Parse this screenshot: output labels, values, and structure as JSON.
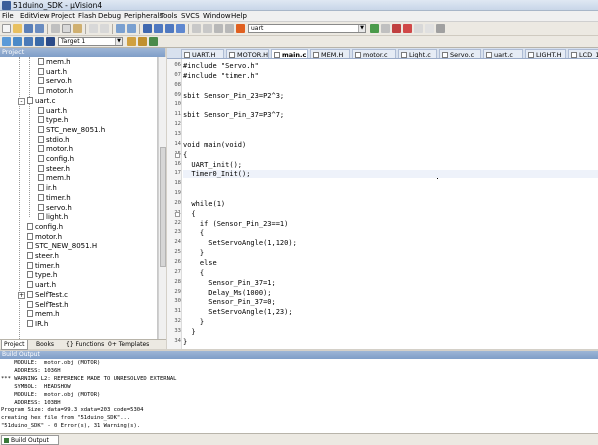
{
  "window": {
    "title": "51duino_SDK - µVision4"
  },
  "menu": [
    "File",
    "Edit",
    "View",
    "Project",
    "Flash",
    "Debug",
    "Peripherals",
    "Tools",
    "SVCS",
    "Window",
    "Help"
  ],
  "toolbar": {
    "find_combo": "uart",
    "target_combo": "Target 1"
  },
  "project_panel": {
    "header": "Project",
    "tree": [
      {
        "label": "mem.h",
        "level": 3,
        "expander": ""
      },
      {
        "label": "uart.h",
        "level": 3,
        "expander": ""
      },
      {
        "label": "servo.h",
        "level": 3,
        "expander": ""
      },
      {
        "label": "motor.h",
        "level": 3,
        "expander": ""
      },
      {
        "label": "uart.c",
        "level": 2,
        "expander": "-"
      },
      {
        "label": "uart.h",
        "level": 3,
        "expander": ""
      },
      {
        "label": "type.h",
        "level": 3,
        "expander": ""
      },
      {
        "label": "STC_new_8051.h",
        "level": 3,
        "expander": ""
      },
      {
        "label": "stdio.h",
        "level": 3,
        "expander": ""
      },
      {
        "label": "motor.h",
        "level": 3,
        "expander": ""
      },
      {
        "label": "config.h",
        "level": 3,
        "expander": ""
      },
      {
        "label": "steer.h",
        "level": 3,
        "expander": ""
      },
      {
        "label": "mem.h",
        "level": 3,
        "expander": ""
      },
      {
        "label": "ir.h",
        "level": 3,
        "expander": ""
      },
      {
        "label": "timer.h",
        "level": 3,
        "expander": ""
      },
      {
        "label": "servo.h",
        "level": 3,
        "expander": ""
      },
      {
        "label": "light.h",
        "level": 3,
        "expander": ""
      },
      {
        "label": "config.h",
        "level": 2,
        "expander": ""
      },
      {
        "label": "motor.h",
        "level": 2,
        "expander": ""
      },
      {
        "label": "STC_NEW_8051.H",
        "level": 2,
        "expander": ""
      },
      {
        "label": "steer.h",
        "level": 2,
        "expander": ""
      },
      {
        "label": "timer.h",
        "level": 2,
        "expander": ""
      },
      {
        "label": "type.h",
        "level": 2,
        "expander": ""
      },
      {
        "label": "uart.h",
        "level": 2,
        "expander": ""
      },
      {
        "label": "SelfTest.c",
        "level": 2,
        "expander": "+"
      },
      {
        "label": "SelfTest.h",
        "level": 2,
        "expander": ""
      },
      {
        "label": "mem.h",
        "level": 2,
        "expander": ""
      },
      {
        "label": "IR.h",
        "level": 2,
        "expander": ""
      }
    ],
    "tabs": [
      "Project",
      "Books",
      "{} Functions",
      "0+ Templates"
    ]
  },
  "editor_tabs": [
    {
      "label": "UART.H",
      "active": false
    },
    {
      "label": "MOTOR.H",
      "active": false
    },
    {
      "label": "main.c",
      "active": true
    },
    {
      "label": "MEM.H",
      "active": false
    },
    {
      "label": "motor.c",
      "active": false
    },
    {
      "label": "Light.c",
      "active": false
    },
    {
      "label": "Servo.c",
      "active": false
    },
    {
      "label": "uart.c",
      "active": false
    },
    {
      "label": "LIGHT.H",
      "active": false
    },
    {
      "label": "LCD_128",
      "active": false
    }
  ],
  "code_lines": [
    {
      "n": "06",
      "text": "#include \"Servo.h\""
    },
    {
      "n": "07",
      "text": "#include \"timer.h\""
    },
    {
      "n": "08",
      "text": ""
    },
    {
      "n": "09",
      "text": "sbit Sensor_Pin_23=P2^3;"
    },
    {
      "n": "10",
      "text": ""
    },
    {
      "n": "11",
      "text": "sbit Sensor_Pin_37=P3^7;"
    },
    {
      "n": "12",
      "text": ""
    },
    {
      "n": "13",
      "text": ""
    },
    {
      "n": "14",
      "text": "void main(void)"
    },
    {
      "n": "15",
      "text": "{"
    },
    {
      "n": "16",
      "text": "  UART_init();"
    },
    {
      "n": "17",
      "text": "  Timer0_Init();"
    },
    {
      "n": "18",
      "text": ""
    },
    {
      "n": "19",
      "text": ""
    },
    {
      "n": "20",
      "text": "  while(1)"
    },
    {
      "n": "21",
      "text": "  {"
    },
    {
      "n": "22",
      "text": "    if (Sensor_Pin_23==1)"
    },
    {
      "n": "23",
      "text": "    {"
    },
    {
      "n": "24",
      "text": "      SetServoAngle(1,120);"
    },
    {
      "n": "25",
      "text": "    }"
    },
    {
      "n": "26",
      "text": "    else"
    },
    {
      "n": "27",
      "text": "    {"
    },
    {
      "n": "28",
      "text": "      Sensor_Pin_37=1;"
    },
    {
      "n": "29",
      "text": "      Delay_Ms(1000);"
    },
    {
      "n": "30",
      "text": "      Sensor_Pin_37=0;"
    },
    {
      "n": "31",
      "text": "      SetServoAngle(1,23);"
    },
    {
      "n": "32",
      "text": "    }"
    },
    {
      "n": "33",
      "text": "  }"
    },
    {
      "n": "34",
      "text": "}"
    }
  ],
  "build_output": {
    "header": "Build Output",
    "lines": [
      "    MODULE:  motor.obj (MOTOR)",
      "    ADDRESS: 1036H",
      "*** WARNING L2: REFERENCE MADE TO UNRESOLVED EXTERNAL",
      "    SYMBOL:  HEADSHOW",
      "    MODULE:  motor.obj (MOTOR)",
      "    ADDRESS: 103BH",
      "Program Size: data=99.3 xdata=203 code=5304",
      "creating hex file from \"51duino_SDK\"...",
      "\"51duino_SDK\" - 0 Error(s), 31 Warning(s)."
    ]
  },
  "status_tab": "Build Output"
}
